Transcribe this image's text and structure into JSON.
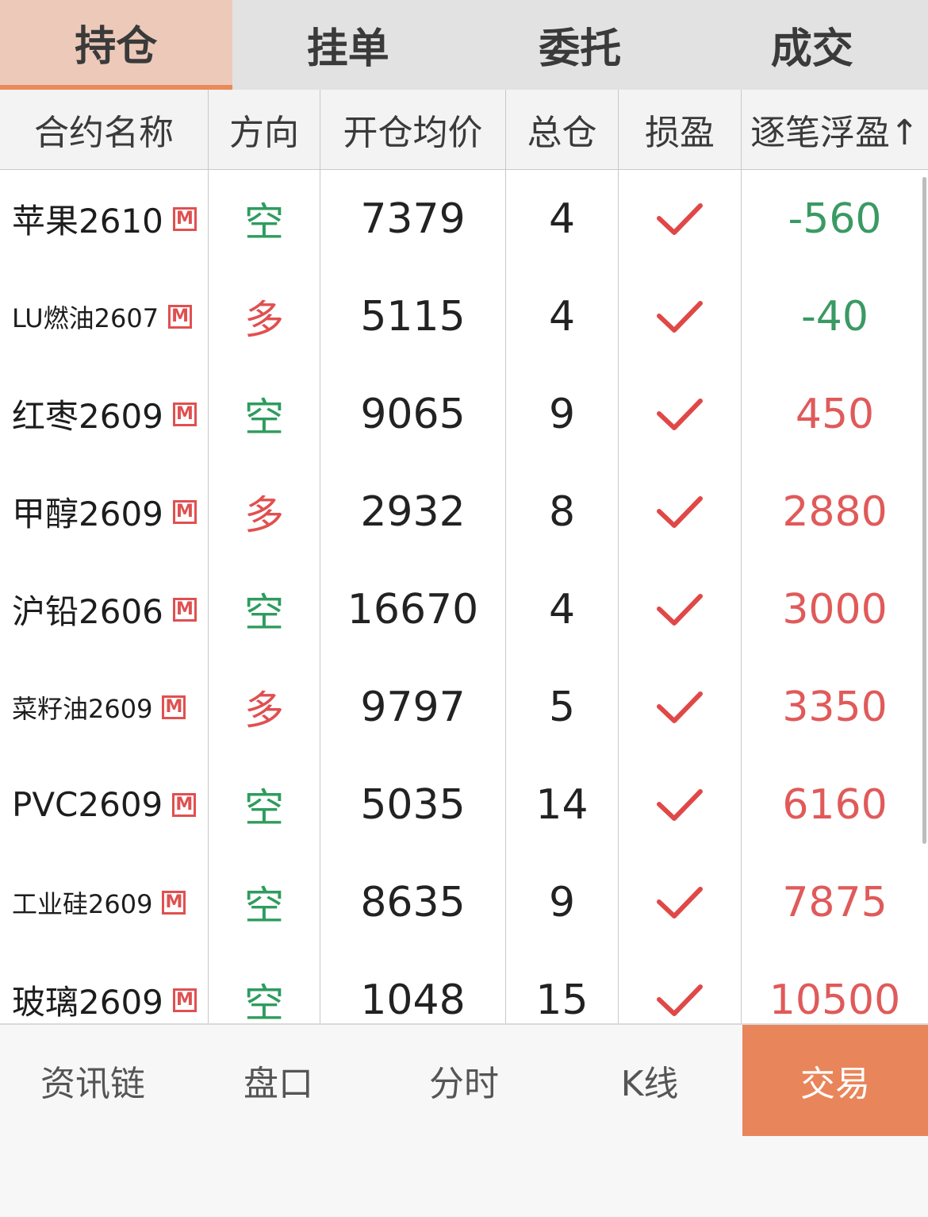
{
  "tabs": [
    {
      "label": "持仓",
      "active": true
    },
    {
      "label": "挂单",
      "active": false
    },
    {
      "label": "委托",
      "active": false
    },
    {
      "label": "成交",
      "active": false
    }
  ],
  "table": {
    "headers": [
      "合约名称",
      "方向",
      "开仓均价",
      "总仓",
      "损盈",
      "逐笔浮盈↑"
    ],
    "rows": [
      {
        "name": "苹果2610",
        "dir": "空",
        "price": "7379",
        "qty": "4",
        "pnl": "-560"
      },
      {
        "name": "LU燃油2607",
        "dir": "多",
        "price": "5115",
        "qty": "4",
        "pnl": "-40"
      },
      {
        "name": "红枣2609",
        "dir": "空",
        "price": "9065",
        "qty": "9",
        "pnl": "450"
      },
      {
        "name": "甲醇2609",
        "dir": "多",
        "price": "2932",
        "qty": "8",
        "pnl": "2880"
      },
      {
        "name": "沪铅2606",
        "dir": "空",
        "price": "16670",
        "qty": "4",
        "pnl": "3000"
      },
      {
        "name": "菜籽油2609",
        "dir": "多",
        "price": "9797",
        "qty": "5",
        "pnl": "3350"
      },
      {
        "name": "PVC2609",
        "dir": "空",
        "price": "5035",
        "qty": "14",
        "pnl": "6160"
      },
      {
        "name": "工业硅2609",
        "dir": "空",
        "price": "8635",
        "qty": "9",
        "pnl": "7875"
      },
      {
        "name": "玻璃2609",
        "dir": "空",
        "price": "1048",
        "qty": "15",
        "pnl": "10500"
      }
    ],
    "badge_label": "M",
    "stop_loss_icon": "check-icon"
  },
  "nav": [
    {
      "label": "资讯链",
      "active": false
    },
    {
      "label": "盘口",
      "active": false
    },
    {
      "label": "分时",
      "active": false
    },
    {
      "label": "K线",
      "active": false
    },
    {
      "label": "交易",
      "active": true
    }
  ],
  "colors": {
    "short": "#2e9c5e",
    "long": "#e05050",
    "loss": "#3a9a63",
    "profit": "#e05a5a",
    "accent": "#e9855a",
    "check": "#e04848"
  }
}
